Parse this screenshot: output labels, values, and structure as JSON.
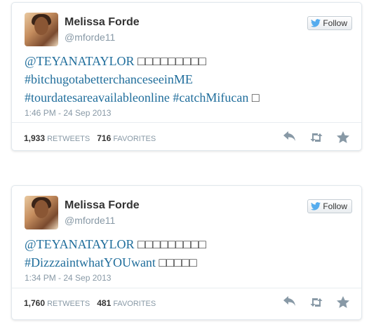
{
  "tweets": [
    {
      "user": {
        "name": "Melissa Forde",
        "handle": "@mforde11"
      },
      "follow_label": "Follow",
      "text_lines": [
        [
          "@TEYANATAYLOR",
          " □□□□□□□□□"
        ],
        [
          "#bitchugotabetterchanceseeinME",
          ""
        ],
        [
          "#tourdatesareavailableonline #catchMifucan",
          " □"
        ]
      ],
      "timestamp": "1:46 PM - 24 Sep 2013",
      "retweets_count": "1,933",
      "retweets_label": "RETWEETS",
      "favorites_count": "716",
      "favorites_label": "FAVORITES"
    },
    {
      "user": {
        "name": "Melissa Forde",
        "handle": "@mforde11"
      },
      "follow_label": "Follow",
      "text_lines": [
        [
          "@TEYANATAYLOR",
          " □□□□□□□□□"
        ],
        [
          "#DizzzaintwhatYOUwant",
          " □□□□□"
        ]
      ],
      "timestamp": "1:34 PM - 24 Sep 2013",
      "retweets_count": "1,760",
      "retweets_label": "RETWEETS",
      "favorites_count": "481",
      "favorites_label": "FAVORITES"
    }
  ],
  "icons": {
    "follow": "twitter-bird-icon",
    "reply": "reply-icon",
    "retweet": "retweet-icon",
    "favorite": "star-icon"
  },
  "colors": {
    "link": "#1f6d9b",
    "muted": "#8899a6",
    "bird": "#55acee"
  }
}
